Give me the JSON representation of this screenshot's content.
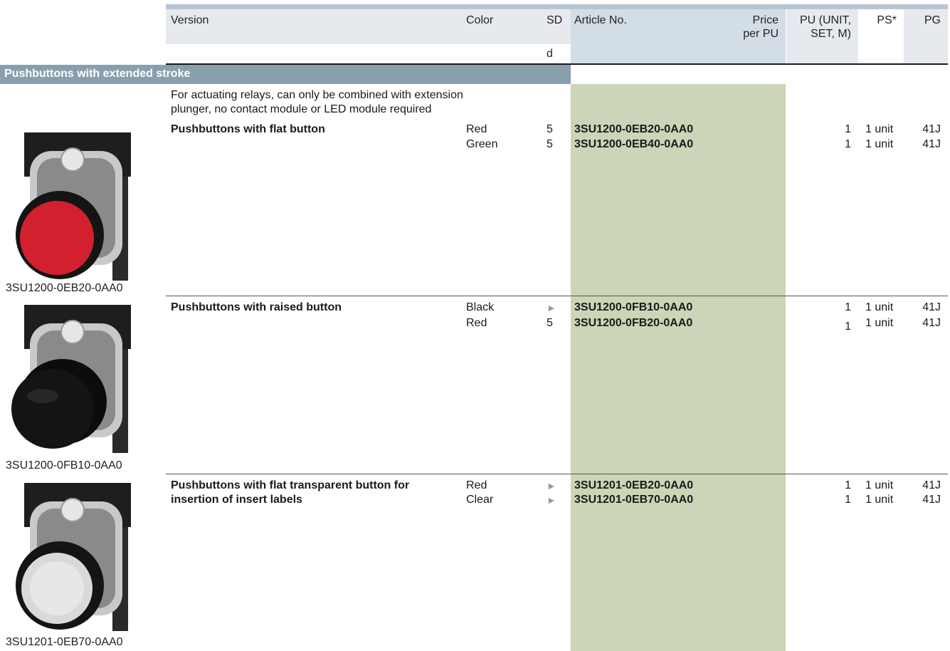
{
  "header": {
    "version": "Version",
    "color": "Color",
    "sd": "SD",
    "sd_unit": "d",
    "article": "Article No.",
    "price_line1": "Price",
    "price_line2": "per PU",
    "pu_line1": "PU (UNIT,",
    "pu_line2": "SET, M)",
    "ps": "PS*",
    "pg": "PG"
  },
  "section": {
    "title": "Pushbuttons with extended stroke",
    "intro_line1": "For actuating relays, can only be combined with extension",
    "intro_line2": "plunger, no contact module or LED module required"
  },
  "groups": [
    {
      "title_line1": "Pushbuttons with flat button",
      "title_line2": "",
      "caption": "3SU1200-0EB20-0AA0",
      "image_color": "#d3202e",
      "rows": [
        {
          "color": "Red",
          "sd": "5",
          "article": "3SU1200-0EB20-0AA0",
          "pu": "1",
          "ps": "1 unit",
          "pg": "41J"
        },
        {
          "color": "Green",
          "sd": "5",
          "article": "3SU1200-0EB40-0AA0",
          "pu": "1",
          "ps": "1 unit",
          "pg": "41J"
        }
      ]
    },
    {
      "title_line1": "Pushbuttons with raised button",
      "title_line2": "",
      "caption": "3SU1200-0FB10-0AA0",
      "image_color": "#141414",
      "rows": [
        {
          "color": "Black",
          "sd": "►",
          "article": "3SU1200-0FB10-0AA0",
          "pu": "1",
          "ps": "1 unit",
          "pg": "41J"
        },
        {
          "color": "Red",
          "sd": "5",
          "article": "3SU1200-0FB20-0AA0",
          "pu": "1",
          "ps": "1 unit",
          "pg": "41J"
        }
      ]
    },
    {
      "title_line1": "Pushbuttons with flat transparent button for",
      "title_line2": "insertion of insert labels",
      "caption": "3SU1201-0EB70-0AA0",
      "image_color": "#d9d9d9",
      "rows": [
        {
          "color": "Red",
          "sd": "►",
          "article": "3SU1201-0EB20-0AA0",
          "pu": "1",
          "ps": "1 unit",
          "pg": "41J"
        },
        {
          "color": "Clear",
          "sd": "►",
          "article": "3SU1201-0EB70-0AA0",
          "pu": "1",
          "ps": "1 unit",
          "pg": "41J"
        }
      ]
    }
  ]
}
